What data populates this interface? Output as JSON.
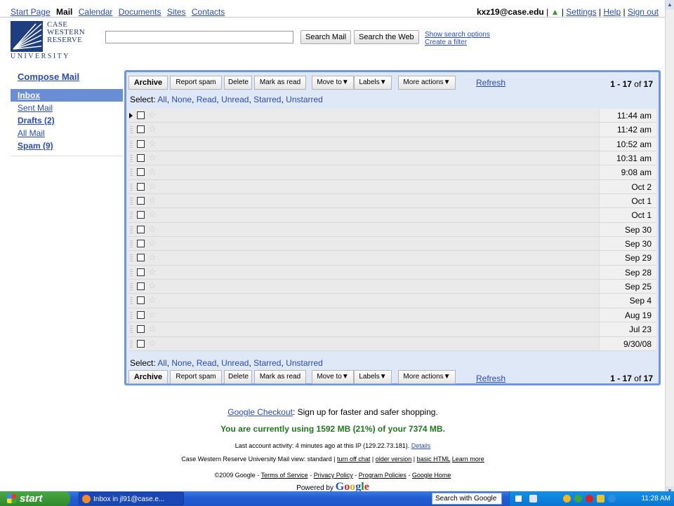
{
  "topnav": {
    "items": [
      {
        "label": "Start Page",
        "current": false
      },
      {
        "label": "Mail",
        "current": true
      },
      {
        "label": "Calendar",
        "current": false
      },
      {
        "label": "Documents",
        "current": false
      },
      {
        "label": "Sites",
        "current": false
      },
      {
        "label": "Contacts",
        "current": false
      }
    ],
    "user_email": "kxz19@case.edu",
    "sep": "|",
    "settings": "Settings",
    "help": "Help",
    "signout": "Sign out"
  },
  "logo": {
    "line1": "CASE",
    "line2": "WESTERN",
    "line3": "RESERVE",
    "line4": "UNIVERSITY"
  },
  "search": {
    "value": "",
    "search_mail": "Search Mail",
    "search_web": "Search the Web",
    "show_options": "Show search options",
    "create_filter": "Create a filter"
  },
  "sidebar": {
    "compose": "Compose Mail",
    "items": [
      {
        "label": "Inbox"
      },
      {
        "label": "Sent Mail"
      },
      {
        "label": "Drafts (2)"
      },
      {
        "label": "All Mail"
      },
      {
        "label": "Spam (9)"
      }
    ]
  },
  "toolbar": {
    "archive": "Archive",
    "report_spam": "Report spam",
    "delete": "Delete",
    "mark_as_read": "Mark as read",
    "move_to": "Move to▼",
    "labels": "Labels▼",
    "more_actions": "More actions▼",
    "refresh": "Refresh",
    "pager_range": "1 - 17",
    "pager_of": "of",
    "pager_total": "17"
  },
  "select": {
    "label": "Select:",
    "options": [
      "All",
      "None",
      "Read",
      "Unread",
      "Starred",
      "Unstarred"
    ]
  },
  "messages": [
    {
      "date": "11:44 am"
    },
    {
      "date": "11:42 am"
    },
    {
      "date": "10:52 am"
    },
    {
      "date": "10:31 am"
    },
    {
      "date": "9:08 am"
    },
    {
      "date": "Oct 2"
    },
    {
      "date": "Oct 1"
    },
    {
      "date": "Oct 1"
    },
    {
      "date": "Sep 30"
    },
    {
      "date": "Sep 30"
    },
    {
      "date": "Sep 29"
    },
    {
      "date": "Sep 28"
    },
    {
      "date": "Sep 25"
    },
    {
      "date": "Sep 4"
    },
    {
      "date": "Aug 19"
    },
    {
      "date": "Jul 23"
    },
    {
      "date": "9/30/08"
    }
  ],
  "footer": {
    "checkout_link": "Google Checkout",
    "checkout_text": ": Sign up for faster and safer shopping.",
    "usage": "You are currently using 1592 MB (21%) of your 7374 MB.",
    "activity": "Last account activity: 4 minutes ago at this IP (129.22.73.181).",
    "details": "Details",
    "view_prefix": "Case Western Reserve University Mail view: standard |",
    "turn_off_chat": "turn off chat",
    "older_version": "older version",
    "basic_html": "basic HTML",
    "learn_more": "Learn more",
    "copyright": "©2009 Google -",
    "terms": "Terms of Service",
    "privacy": "Privacy Policy",
    "program": "Program Policies",
    "google_home": "Google Home",
    "dash": "-",
    "powered_by": "Powered by",
    "google": [
      "G",
      "o",
      "o",
      "g",
      "l",
      "e"
    ]
  },
  "taskbar": {
    "start": "start",
    "task_item": "Inbox in jl91@case.e...",
    "search": "Search with Google",
    "clock": "11:28 AM"
  },
  "colors": {
    "accent": "#6e97dd",
    "link": "#2a4bb0",
    "usage_green": "#1c7a1c"
  }
}
